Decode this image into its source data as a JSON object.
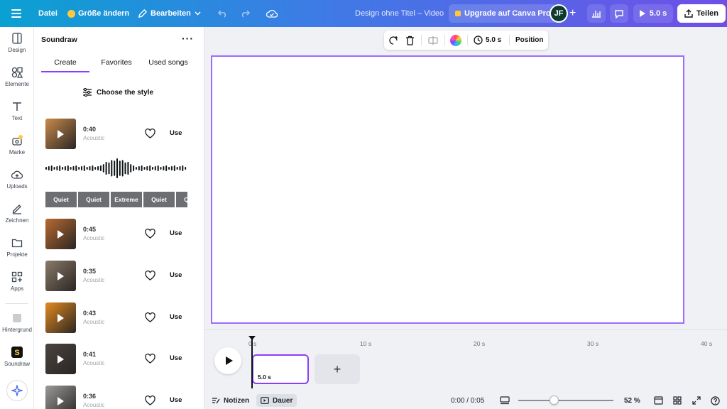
{
  "topbar": {
    "file_label": "Datei",
    "resize_label": "Größe ändern",
    "edit_label": "Bearbeiten",
    "doc_title": "Design ohne Titel – Video",
    "upgrade_label": "Upgrade auf Canva Pro",
    "avatar_initials": "JF",
    "play_duration": "5.0 s",
    "share_label": "Teilen"
  },
  "rail": {
    "items": [
      {
        "label": "Design",
        "icon": "design-icon"
      },
      {
        "label": "Elemente",
        "icon": "elements-icon"
      },
      {
        "label": "Text",
        "icon": "text-icon"
      },
      {
        "label": "Marke",
        "icon": "brand-icon"
      },
      {
        "label": "Uploads",
        "icon": "upload-icon"
      },
      {
        "label": "Zeichnen",
        "icon": "draw-icon"
      },
      {
        "label": "Projekte",
        "icon": "folder-icon"
      },
      {
        "label": "Apps",
        "icon": "apps-icon"
      },
      {
        "label": "Hintergrund",
        "icon": "background-icon"
      },
      {
        "label": "Soundraw",
        "icon": "soundraw-icon"
      }
    ]
  },
  "panel": {
    "title": "Soundraw",
    "tabs": [
      "Create",
      "Favorites",
      "Used songs"
    ],
    "style_button": "Choose the style",
    "use_label": "Use",
    "segments": [
      "Quiet",
      "Quiet",
      "Extreme",
      "Quiet",
      "Quiet"
    ],
    "songs": [
      {
        "duration": "0:40",
        "genre": "Acoustic",
        "thumb_color": "#c98a4a"
      },
      {
        "duration": "0:45",
        "genre": "Acoustic",
        "thumb_color": "#b86a30"
      },
      {
        "duration": "0:35",
        "genre": "Acoustic",
        "thumb_color": "#8a7a68"
      },
      {
        "duration": "0:43",
        "genre": "Acoustic",
        "thumb_color": "#e38a1e"
      },
      {
        "duration": "0:41",
        "genre": "Acoustic",
        "thumb_color": "#4a4440"
      },
      {
        "duration": "0:36",
        "genre": "Acoustic",
        "thumb_color": "#9a9a9a"
      }
    ]
  },
  "float_toolbar": {
    "duration": "5.0 s",
    "position_label": "Position"
  },
  "timeline": {
    "ticks": [
      "0 s",
      "10 s",
      "20 s",
      "30 s",
      "40 s"
    ],
    "clip_label": "5.0 s",
    "add_label": "+",
    "notes_label": "Notizen",
    "duration_label": "Dauer",
    "time_readout": "0:00 / 0:05",
    "zoom_value": "52 %",
    "zoom_fraction": 0.52
  }
}
